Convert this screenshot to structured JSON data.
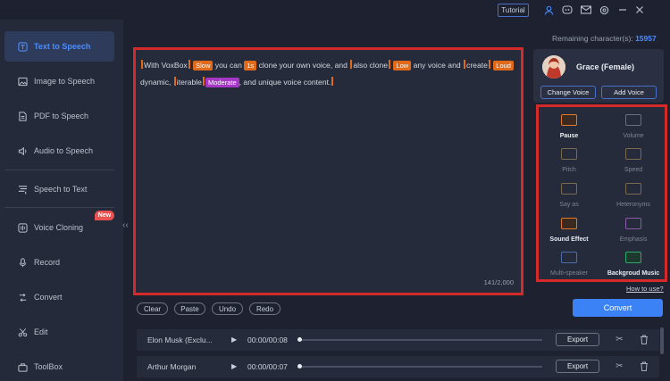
{
  "titlebar": {
    "tutorial": "Tutorial"
  },
  "sidebar": {
    "items": [
      {
        "label": "Text to Speech",
        "icon": "text-to-speech-icon",
        "active": true
      },
      {
        "label": "Image to Speech",
        "icon": "image-icon"
      },
      {
        "label": "PDF to Speech",
        "icon": "pdf-icon"
      },
      {
        "label": "Audio to Speech",
        "icon": "audio-icon"
      },
      {
        "label": "Speech to Text",
        "icon": "speech-to-text-icon"
      },
      {
        "label": "Voice Cloning",
        "icon": "voice-cloning-icon",
        "badge": "New"
      },
      {
        "label": "Record",
        "icon": "microphone-icon"
      },
      {
        "label": "Convert",
        "icon": "convert-icon"
      },
      {
        "label": "Edit",
        "icon": "scissors-icon"
      },
      {
        "label": "ToolBox",
        "icon": "toolbox-icon"
      }
    ]
  },
  "editor": {
    "seg": [
      "With VoxBox",
      "Slow",
      "you can",
      "1s",
      "clone your own voice, and",
      "also clone",
      "Low",
      "any voice and",
      "create",
      "Loud",
      "dynamic,",
      "iterable",
      "Moderate",
      ", and unique voice content."
    ],
    "char_count": "141/2,000"
  },
  "actions": {
    "clear": "Clear",
    "paste": "Paste",
    "undo": "Undo",
    "redo": "Redo"
  },
  "remaining": {
    "label": "Remaining character(s):",
    "value": "15957"
  },
  "voice": {
    "name": "Grace (Female)",
    "change": "Change Voice",
    "add": "Add Voice"
  },
  "effects": [
    {
      "label": "Pause",
      "enabled": true,
      "color": "#e07a2a"
    },
    {
      "label": "Volume",
      "enabled": false,
      "color": "#6a6f7e"
    },
    {
      "label": "Pitch",
      "enabled": false,
      "color": "#7a6a50"
    },
    {
      "label": "Speed",
      "enabled": false,
      "color": "#7a6a50"
    },
    {
      "label": "Say as",
      "enabled": false,
      "color": "#7a6a50"
    },
    {
      "label": "Heteronyms",
      "enabled": false,
      "color": "#7a6a50"
    },
    {
      "label": "Sound Effect",
      "enabled": true,
      "color": "#e07a2a"
    },
    {
      "label": "Emphasis",
      "enabled": false,
      "color": "#8a5aa8"
    },
    {
      "label": "Multi-speaker",
      "enabled": false,
      "color": "#4a6fa8"
    },
    {
      "label": "Backgroud Music",
      "enabled": true,
      "color": "#2ea86a"
    }
  ],
  "howto": "How to use?",
  "convert": "Convert",
  "history": [
    {
      "name": "Elon Musk (Exclu...",
      "time": "00:00/00:08",
      "export": "Export"
    },
    {
      "name": "Arthur Morgan",
      "time": "00:00/00:07",
      "export": "Export"
    }
  ],
  "colors": {
    "accent": "#3a82f5",
    "highlight": "#d42a2a",
    "tag_orange": "#e06a1a",
    "tag_purple": "#a637c7"
  }
}
